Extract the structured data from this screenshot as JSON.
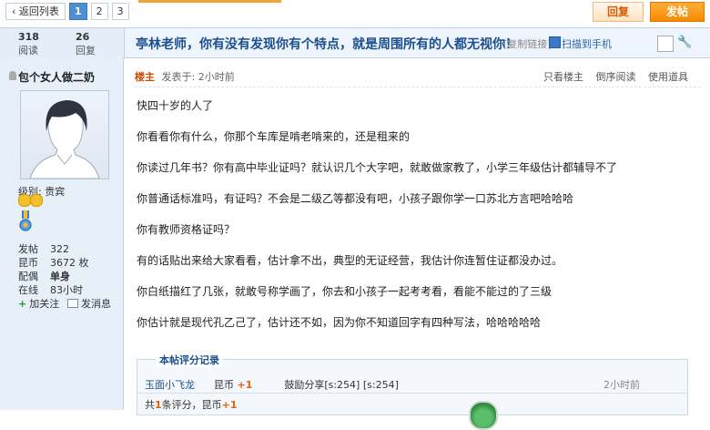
{
  "topbar": {
    "back_label": "返回列表",
    "pages": [
      "1",
      "2",
      "3"
    ],
    "current_page": "1",
    "reply_label": "回复",
    "post_label": "发帖"
  },
  "stats": {
    "views": "318",
    "views_label": "阅读",
    "replies": "26",
    "replies_label": "回复"
  },
  "thread": {
    "title": "亭林老师，你有没有发现你有个特点，就是周围所有的人都无视你！",
    "copy_link": "[复制链接]",
    "scan_mobile": "扫描到手机"
  },
  "user": {
    "name": "包个女人做二奶",
    "level": "级别: 贵宾",
    "rows": [
      {
        "k": "发帖",
        "v": "322"
      },
      {
        "k": "昆币",
        "v": "3672 枚"
      },
      {
        "k": "配偶",
        "v": "单身"
      },
      {
        "k": "在线",
        "v": "83小时"
      }
    ],
    "follow_label": "加关注",
    "message_label": "发消息"
  },
  "post": {
    "op_badge": "楼主",
    "posted": "发表于: 2小时前",
    "tools": [
      "只看楼主",
      "倒序阅读",
      "使用道具"
    ],
    "lines": [
      "快四十岁的人了",
      "你看看你有什么，你那个车库是啃老啃来的，还是租来的",
      "你读过几年书？你有高中毕业证吗？就认识几个大字吧，就敢做家教了，小学三年级估计都辅导不了",
      "你普通话标准吗，有证吗？不会是二级乙等都没有吧，小孩子跟你学一口苏北方言吧哈哈哈",
      "你有教师资格证吗？",
      "有的话贴出来给大家看看，估计拿不出，典型的无证经营，我估计你连暂住证都没办过。",
      "你白纸描红了几张，就敢号称学画了，你去和小孩子一起考考看，看能不能过的了三级",
      "你估计就是现代孔乙己了，估计还不如，因为你不知道回字有四种写法，哈哈哈哈哈"
    ]
  },
  "rating": {
    "title": "本帖评分记录",
    "rater": "玉面小飞龙",
    "currency": "昆币",
    "amount": "+1",
    "reason": "鼓励分享[s:254] [s:254]",
    "time": "2小时前",
    "summary_prefix": "共",
    "summary_count": "1",
    "summary_suffix": "条评分，昆币",
    "summary_amount": "+1"
  },
  "colors": {
    "accent_blue": "#4d8fd1",
    "title_blue": "#1c4f8c",
    "orange": "#f48b00"
  }
}
